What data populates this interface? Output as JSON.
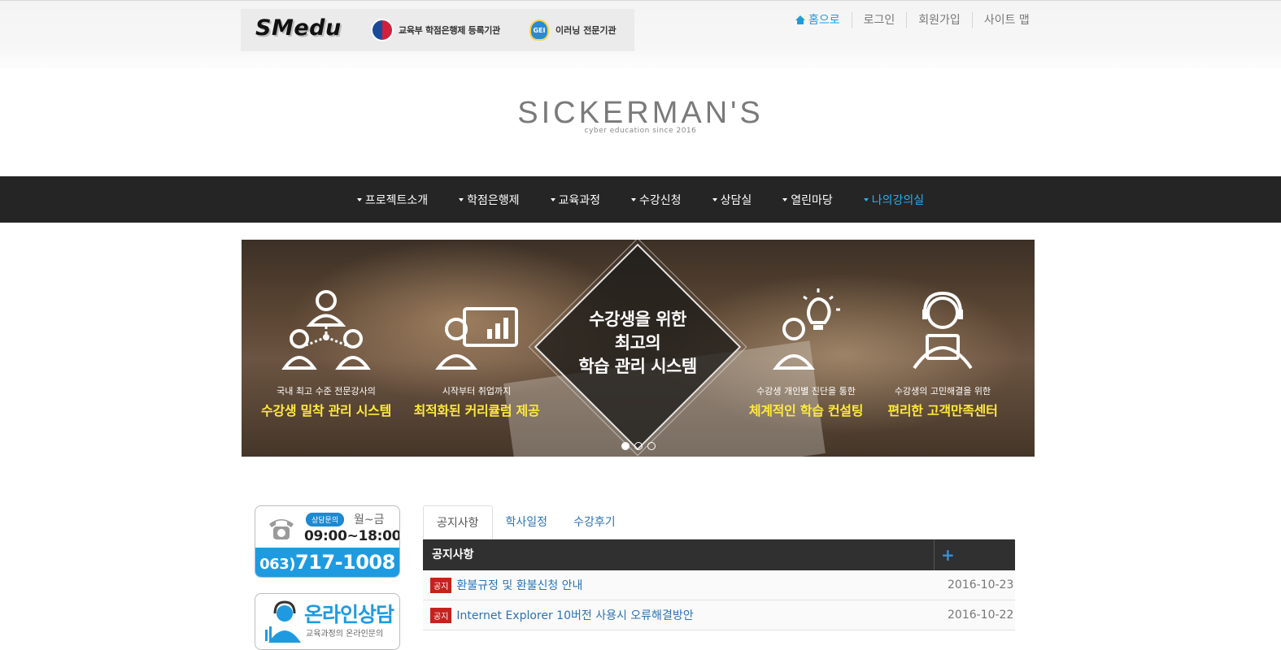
{
  "header": {
    "logo": "SMedu",
    "gov_badge": "교육부 학점은행제 등록기관",
    "gei_icon_text": "GEI",
    "gei_badge": "이러닝 전문기관",
    "util_nav": [
      "홈으로",
      "로그인",
      "회원가입",
      "사이트 맵"
    ]
  },
  "site": {
    "title": "SICKERMAN'S",
    "subtitle": "cyber education since 2016"
  },
  "main_nav": [
    "프로젝트소개",
    "학점은행제",
    "교육과정",
    "수강신청",
    "상담실",
    "열린마당",
    "나의강의실"
  ],
  "banner": {
    "features": [
      {
        "small": "국내 최고 수준 전문강사의",
        "big": "수강생 밀착 관리 시스템",
        "icon": "people-network-icon"
      },
      {
        "small": "시작부터 취업까지",
        "big": "최적화된 커리큘럼 제공",
        "icon": "presenter-chart-icon"
      },
      {
        "small": "수강생 개인별 진단을 통한",
        "big": "체계적인 학습 컨설팅",
        "icon": "idea-person-icon"
      },
      {
        "small": "수강생의 고민해결을 위한",
        "big": "편리한 고객만족센터",
        "icon": "headset-support-icon"
      }
    ],
    "center_lines": [
      "수강생을 위한",
      "최고의",
      "학습 관리 시스템"
    ],
    "slide_count": 3,
    "active_slide": 1
  },
  "callbox": {
    "tag": "상담문의",
    "days": "월~금",
    "hours": "09:00~18:00",
    "area": "063)",
    "number": "717-1008"
  },
  "online": {
    "title": "온라인상담",
    "desc": "교육과정의 온라인문의"
  },
  "tabs": [
    "공지사항",
    "학사일정",
    "수강후기"
  ],
  "board": {
    "header_title": "공지사항",
    "more": "+",
    "rows": [
      {
        "badge": "공지",
        "subject": "환불규정 및 환불신청 안내",
        "date": "2016-10-23"
      },
      {
        "badge": "공지",
        "subject": "Internet Explorer 10버전 사용시 오류해결방안",
        "date": "2016-10-22"
      }
    ]
  },
  "colors": {
    "accent": "#1e9be0",
    "nav_bg": "#252525",
    "nav_active": "#2ab0f0",
    "highlight_yellow": "#ffe93b",
    "badge_red": "#c3231e"
  }
}
